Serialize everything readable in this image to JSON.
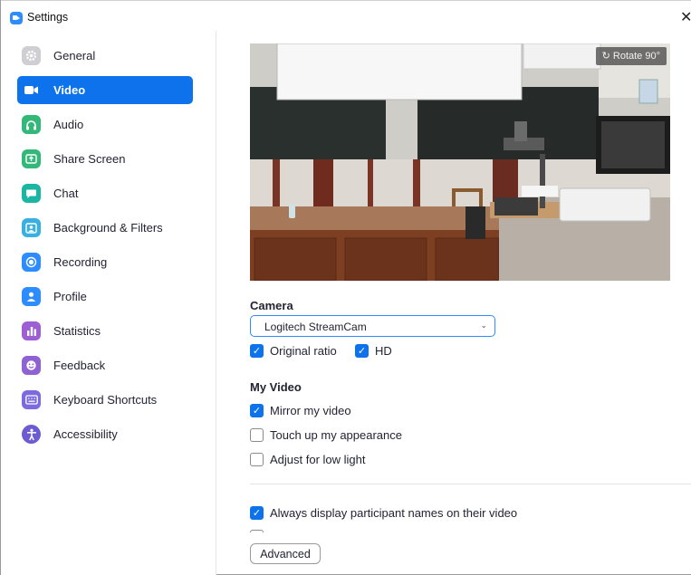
{
  "window": {
    "title": "Settings",
    "close_glyph": "✕"
  },
  "sidebar": {
    "items": [
      {
        "label": "General",
        "icon": "gear-icon",
        "active": false
      },
      {
        "label": "Video",
        "icon": "video-camera-icon",
        "active": true
      },
      {
        "label": "Audio",
        "icon": "headphones-icon",
        "active": false
      },
      {
        "label": "Share Screen",
        "icon": "share-screen-icon",
        "active": false
      },
      {
        "label": "Chat",
        "icon": "chat-bubble-icon",
        "active": false
      },
      {
        "label": "Background & Filters",
        "icon": "background-icon",
        "active": false
      },
      {
        "label": "Recording",
        "icon": "record-icon",
        "active": false
      },
      {
        "label": "Profile",
        "icon": "profile-icon",
        "active": false
      },
      {
        "label": "Statistics",
        "icon": "bar-chart-icon",
        "active": false
      },
      {
        "label": "Feedback",
        "icon": "smiley-icon",
        "active": false
      },
      {
        "label": "Keyboard Shortcuts",
        "icon": "keyboard-icon",
        "active": false
      },
      {
        "label": "Accessibility",
        "icon": "accessibility-icon",
        "active": false
      }
    ]
  },
  "main": {
    "preview": {
      "rotate_label": "Rotate 90°"
    },
    "camera": {
      "title": "Camera",
      "selected": "Logitech StreamCam",
      "original_ratio": {
        "label": "Original ratio",
        "checked": true
      },
      "hd": {
        "label": "HD",
        "checked": true
      }
    },
    "my_video": {
      "title": "My Video",
      "mirror": {
        "label": "Mirror my video",
        "checked": true
      },
      "touch_up": {
        "label": "Touch up my appearance",
        "checked": false
      },
      "low_light": {
        "label": "Adjust for low light",
        "checked": false
      }
    },
    "always_display_names": {
      "label": "Always display participant names on their video",
      "checked": true
    },
    "advanced_label": "Advanced"
  },
  "colors": {
    "accent": "#0e72ed",
    "border_focus": "#2d8cff"
  }
}
